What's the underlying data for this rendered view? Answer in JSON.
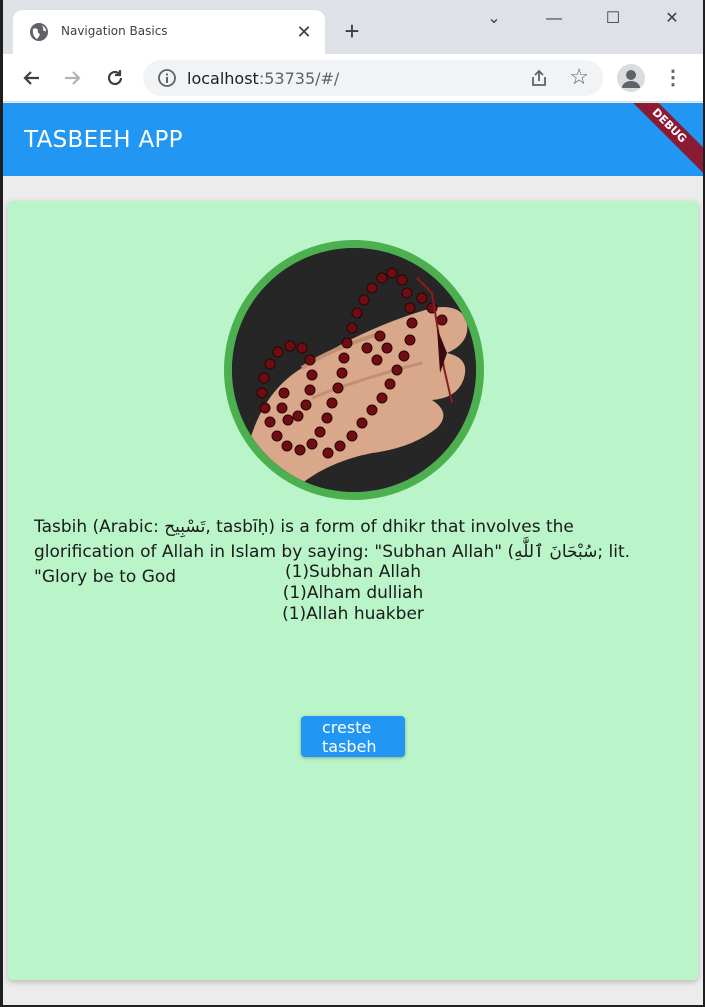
{
  "browser": {
    "tab_title": "Navigation Basics",
    "url_host": "localhost",
    "url_rest": ":53735/#/"
  },
  "app": {
    "title": "TASBEEH APP",
    "debug_banner": "DEBUG",
    "description": "Tasbih (Arabic: تَسْبِيح, tasbīḥ) is a form of dhikr that involves the glorification of Allah in Islam by saying: \"Subhan Allah\" (سُبْحَانَ ٱللَّٰهِ; lit. \"Glory be to God",
    "lines": [
      "(1)Subhan Allah",
      "(1)Alham dulliah",
      "(1)Allah huakber"
    ],
    "button_line1": "creste",
    "button_line2": "tasbeh"
  },
  "colors": {
    "appbar": "#2196f3",
    "card": "#b9f5c9",
    "ring": "#4caf50",
    "button": "#2196f3",
    "debug": "#8b1a35"
  }
}
